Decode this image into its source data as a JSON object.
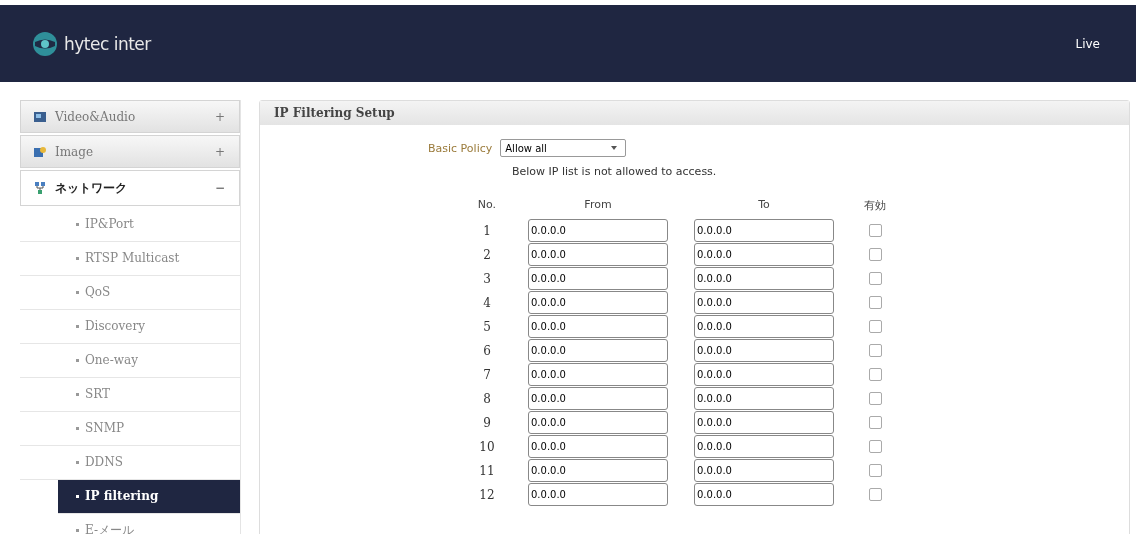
{
  "header": {
    "logo_text": "hytec inter",
    "nav_link": "Live"
  },
  "sidebar": {
    "groups": [
      {
        "label": "Video&Audio",
        "expanded": false,
        "toggle": "+"
      },
      {
        "label": "Image",
        "expanded": false,
        "toggle": "+"
      },
      {
        "label": "ネットワーク",
        "expanded": true,
        "toggle": "−",
        "children": [
          {
            "label": "IP&Port",
            "selected": false
          },
          {
            "label": "RTSP Multicast",
            "selected": false
          },
          {
            "label": "QoS",
            "selected": false
          },
          {
            "label": "Discovery",
            "selected": false
          },
          {
            "label": "One-way",
            "selected": false
          },
          {
            "label": "SRT",
            "selected": false
          },
          {
            "label": "SNMP",
            "selected": false
          },
          {
            "label": "DDNS",
            "selected": false
          },
          {
            "label": "IP filtering",
            "selected": true
          },
          {
            "label": "E-メール",
            "selected": false
          }
        ]
      }
    ]
  },
  "panel": {
    "title": "IP Filtering Setup",
    "policy_label": "Basic Policy",
    "policy_value": "Allow all",
    "note": "Below IP list is not allowed to access.",
    "columns": [
      "No.",
      "From",
      "To",
      "有効"
    ],
    "rows": [
      {
        "no": "1",
        "from": "0.0.0.0",
        "to": "0.0.0.0",
        "checked": false
      },
      {
        "no": "2",
        "from": "0.0.0.0",
        "to": "0.0.0.0",
        "checked": false
      },
      {
        "no": "3",
        "from": "0.0.0.0",
        "to": "0.0.0.0",
        "checked": false
      },
      {
        "no": "4",
        "from": "0.0.0.0",
        "to": "0.0.0.0",
        "checked": false
      },
      {
        "no": "5",
        "from": "0.0.0.0",
        "to": "0.0.0.0",
        "checked": false
      },
      {
        "no": "6",
        "from": "0.0.0.0",
        "to": "0.0.0.0",
        "checked": false
      },
      {
        "no": "7",
        "from": "0.0.0.0",
        "to": "0.0.0.0",
        "checked": false
      },
      {
        "no": "8",
        "from": "0.0.0.0",
        "to": "0.0.0.0",
        "checked": false
      },
      {
        "no": "9",
        "from": "0.0.0.0",
        "to": "0.0.0.0",
        "checked": false
      },
      {
        "no": "10",
        "from": "0.0.0.0",
        "to": "0.0.0.0",
        "checked": false
      },
      {
        "no": "11",
        "from": "0.0.0.0",
        "to": "0.0.0.0",
        "checked": false
      },
      {
        "no": "12",
        "from": "0.0.0.0",
        "to": "0.0.0.0",
        "checked": false
      }
    ]
  }
}
